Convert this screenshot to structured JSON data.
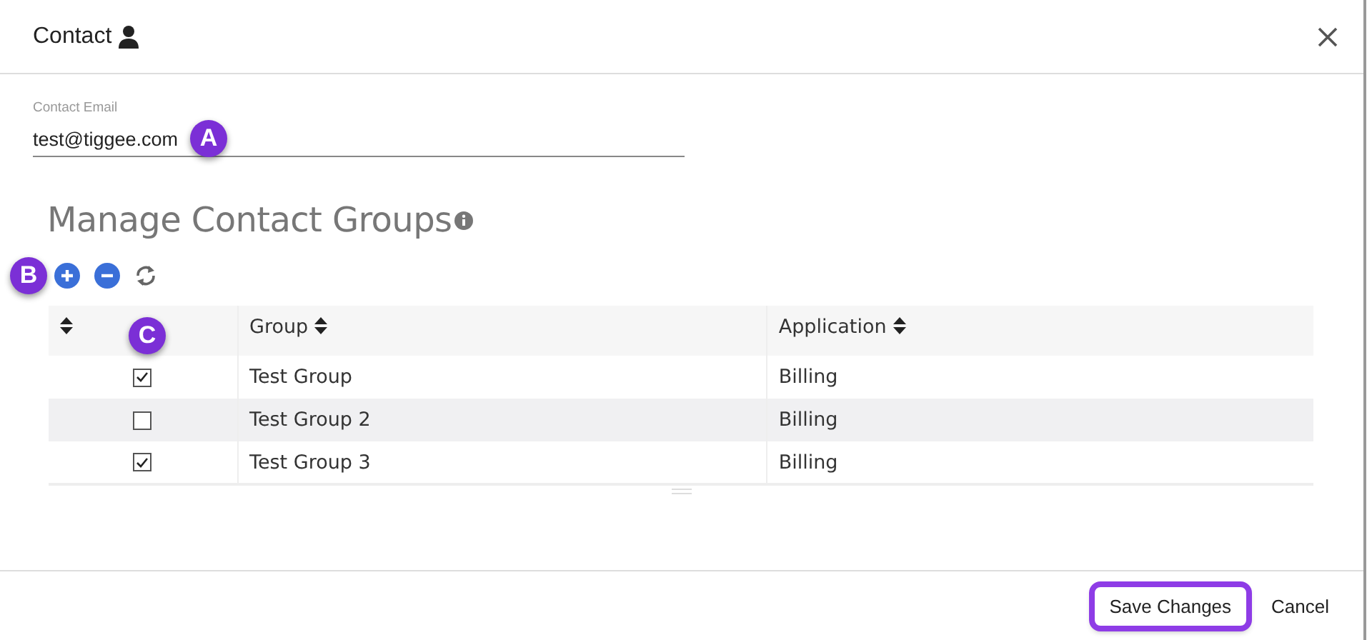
{
  "dialog": {
    "title": "Contact"
  },
  "email": {
    "label": "Contact Email",
    "value": "test@tiggee.com",
    "callout": "A"
  },
  "toolbar": {
    "callout": "B"
  },
  "section": {
    "heading": "Manage Contact Groups"
  },
  "table": {
    "callout": "C",
    "columns": [
      {
        "label": "Group"
      },
      {
        "label": "Application"
      }
    ],
    "rows": [
      {
        "checked": true,
        "group": "Test Group",
        "application": "Billing"
      },
      {
        "checked": false,
        "group": "Test Group 2",
        "application": "Billing"
      },
      {
        "checked": true,
        "group": "Test Group 3",
        "application": "Billing"
      }
    ]
  },
  "buttons": [
    {
      "label": "Save Changes",
      "highlighted": true
    },
    {
      "label": "Cancel",
      "highlighted": false
    }
  ]
}
